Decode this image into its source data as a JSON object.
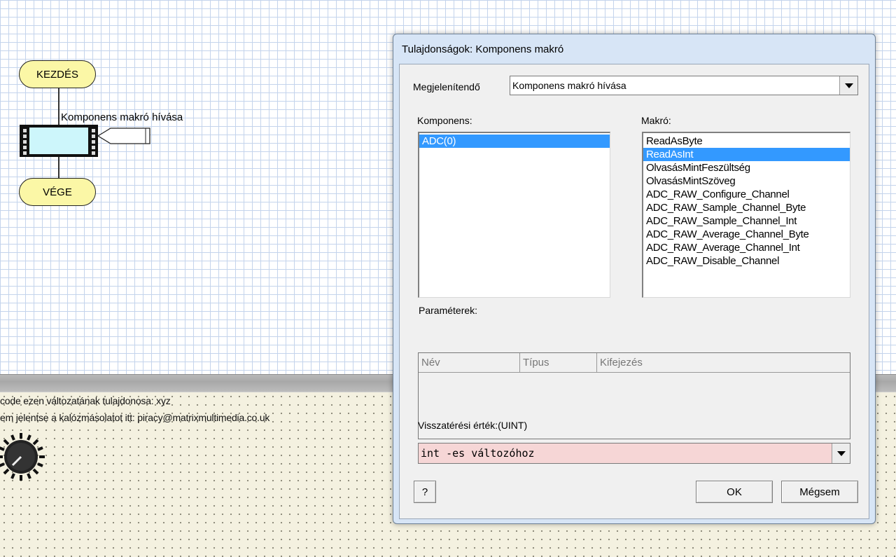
{
  "flowchart": {
    "start_label": "KEZDÉS",
    "end_label": "VÉGE",
    "macro_label": "Komponens makró hívása"
  },
  "panel": {
    "line1": "code ezen változatának tulajdonosa: xyz",
    "line2": "em jelentse a kalózmásolatot itt: piracy@matrixmultimedia.co.uk"
  },
  "dialog": {
    "title": "Tulajdonságok: Komponens makró",
    "display_label": "Megjelenítendő",
    "display_value": "Komponens makró hívása",
    "component_label": "Komponens:",
    "components": [
      {
        "label": "ADC(0)",
        "selected": true
      }
    ],
    "macro_label": "Makró:",
    "macros": [
      {
        "label": "ReadAsByte",
        "selected": false
      },
      {
        "label": "ReadAsInt",
        "selected": true
      },
      {
        "label": "OlvasásMintFeszültség",
        "selected": false
      },
      {
        "label": "OlvasásMintSzöveg",
        "selected": false
      },
      {
        "label": "ADC_RAW_Configure_Channel",
        "selected": false
      },
      {
        "label": "ADC_RAW_Sample_Channel_Byte",
        "selected": false
      },
      {
        "label": "ADC_RAW_Sample_Channel_Int",
        "selected": false
      },
      {
        "label": "ADC_RAW_Average_Channel_Byte",
        "selected": false
      },
      {
        "label": "ADC_RAW_Average_Channel_Int",
        "selected": false
      },
      {
        "label": "ADC_RAW_Disable_Channel",
        "selected": false
      }
    ],
    "params_label": "Paraméterek:",
    "params_columns": [
      "Név",
      "Típus",
      "Kifejezés"
    ],
    "return_label": "Visszatérési érték:(UINT)",
    "return_value": "int -es változóhoz",
    "help_button": "?",
    "ok_button": "OK",
    "cancel_button": "Mégsem"
  },
  "colors": {
    "selection": "#3399ff",
    "terminal_fill": "#fbf7a6",
    "macro_fill": "#cdf6fb",
    "return_field": "#f6d6d6"
  }
}
